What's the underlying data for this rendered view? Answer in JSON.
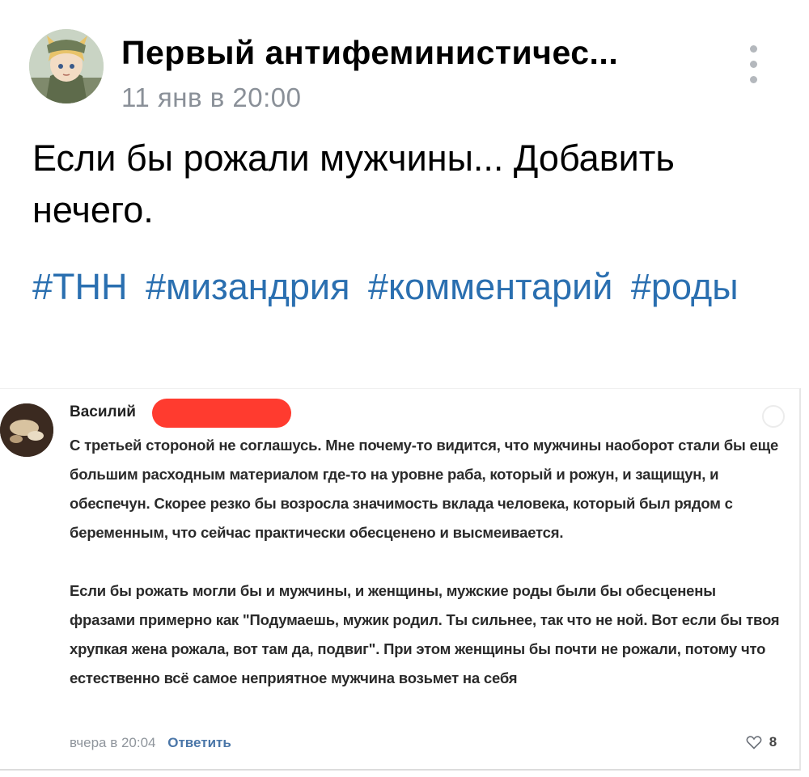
{
  "post": {
    "group_name": "Первый антифеминистичес...",
    "time": "11 янв в 20:00",
    "text": "Если бы рожали мужчины... Добавить нечего.",
    "hashtags": [
      "#ТНН",
      "#мизандрия",
      "#комментарий",
      "#роды"
    ],
    "avatar_icon": "anime-girl-avatar",
    "menu_icon": "more-vertical-icon"
  },
  "comment": {
    "author": "Василий",
    "paragraph_1": "С третьей стороной не соглашусь. Мне почему-то видится, что мужчины наоборот стали бы еще большим расходным материалом где-то на уровне раба, который и рожун, и защищун, и обеспечун. Скорее резко бы возросла значимость вклада человека, который был рядом с беременным, что сейчас практически обесценено и высмеивается.",
    "paragraph_2": "Если бы рожать могли бы и мужчины, и женщины, мужские роды были бы обесценены фразами примерно как \"Подумаешь, мужик родил. Ты сильнее, так что не ной. Вот если бы твоя хрупкая жена рожала, вот там да, подвиг\". При этом женщины бы почти не рожали, потому что естественно всё самое неприятное мужчина возьмет на себя",
    "time": "вчера в 20:04",
    "reply_label": "Ответить",
    "likes": "8",
    "redaction_color": "#ff3b2f",
    "like_icon": "heart-icon"
  },
  "colors": {
    "hashtag": "#2a6fb0",
    "secondary_text": "#8a9098",
    "reply_link": "#4a76a8"
  }
}
